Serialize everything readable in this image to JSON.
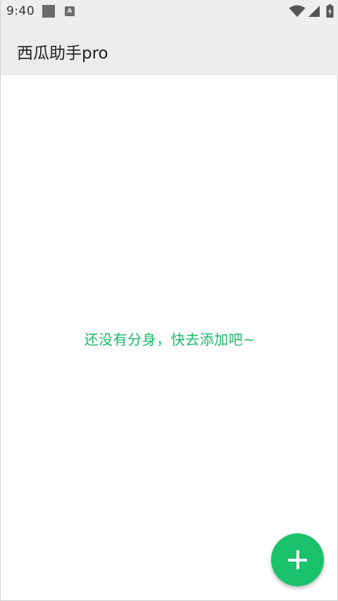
{
  "status_bar": {
    "time": "9:40",
    "notification_icons": [
      "stop-square-icon",
      "a-badge-icon"
    ],
    "notification_a_letter": "A",
    "system_icons": [
      "wifi-icon",
      "signal-icon",
      "battery-icon"
    ]
  },
  "app_bar": {
    "title": "西瓜助手pro"
  },
  "main": {
    "empty_message": "还没有分身，快去添加吧~"
  },
  "fab": {
    "icon": "plus-icon"
  },
  "colors": {
    "accent": "#19c26b",
    "empty_text": "#1aba69",
    "app_bar_bg": "#ececec",
    "status_bar_bg": "#eeeeee",
    "background": "#ffffff"
  }
}
